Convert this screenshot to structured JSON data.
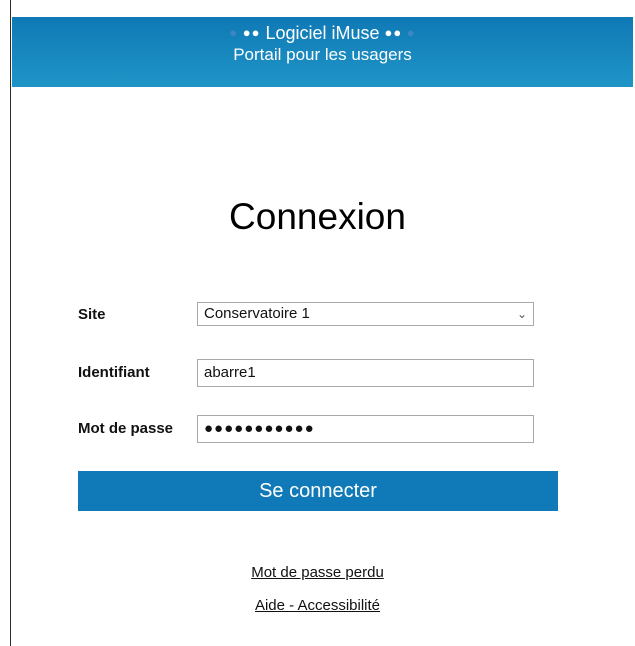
{
  "header": {
    "title": "Logiciel iMuse",
    "subtitle": "Portail pour les usagers"
  },
  "page": {
    "heading": "Connexion"
  },
  "form": {
    "site": {
      "label": "Site",
      "selected": "Conservatoire 1"
    },
    "username": {
      "label": "Identifiant",
      "value": "abarre1"
    },
    "password": {
      "label": "Mot de passe",
      "masked_value": "●●●●●●●●●●●"
    },
    "submit_label": "Se connecter"
  },
  "links": {
    "forgot_password": "Mot de passe perdu",
    "help": "Aide - Accessibilité"
  },
  "colors": {
    "header_bg": "#0f79b5",
    "button_bg": "#0f7ab7",
    "text": "#111111"
  }
}
